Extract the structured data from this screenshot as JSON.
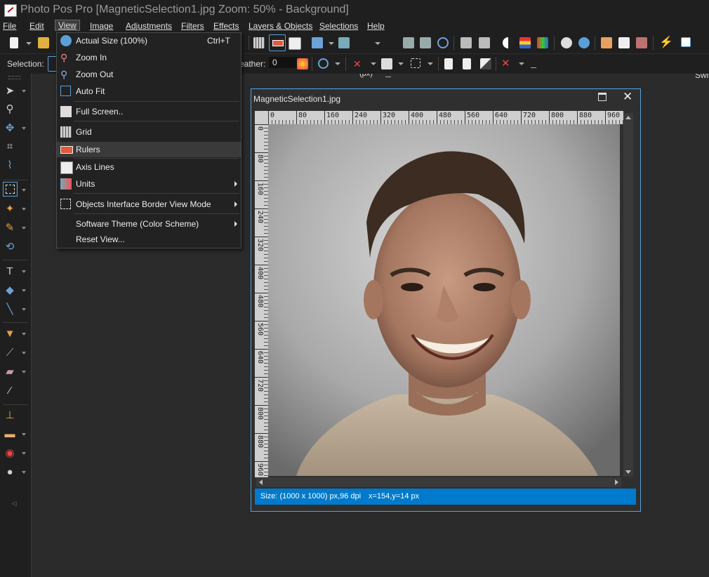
{
  "window": {
    "title": "Photo Pos Pro [MagneticSelection1.jpg Zoom: 50% - Background]"
  },
  "menubar": {
    "items": [
      "File",
      "Edit",
      "View",
      "Image",
      "Adjustments",
      "Filters",
      "Effects",
      "Layers & Objects",
      "Selections",
      "Help"
    ],
    "active": "View"
  },
  "toolbar": {
    "units": "(px)",
    "switch_label": "Swit"
  },
  "toolbar2": {
    "selection_label": "Selection:",
    "feather_label": "eather:",
    "feather_value": "0"
  },
  "view_menu": {
    "items": [
      {
        "label": "Actual Size (100%)",
        "shortcut": "Ctrl+T",
        "icon": "actual-size-icon"
      },
      {
        "label": "Zoom In",
        "icon": "zoom-in-icon"
      },
      {
        "label": "Zoom Out",
        "icon": "zoom-out-icon"
      },
      {
        "label": "Auto Fit",
        "icon": "auto-fit-icon"
      },
      {
        "label": "Full Screen..",
        "icon": "full-screen-icon"
      },
      {
        "label": "Grid",
        "icon": "grid-icon"
      },
      {
        "label": "Rulers",
        "icon": "rulers-icon",
        "highlighted": true
      },
      {
        "label": "Axis Lines",
        "icon": "axis-lines-icon"
      },
      {
        "label": "Units",
        "icon": "units-icon",
        "submenu": true
      },
      {
        "label": "Objects Interface Border View Mode",
        "icon": "border-view-icon",
        "submenu": true
      },
      {
        "label": "Software Theme (Color Scheme)",
        "submenu": true
      },
      {
        "label": "Reset View..."
      }
    ]
  },
  "document": {
    "title": "MagneticSelection1.jpg",
    "h_ruler": [
      "0",
      "80",
      "160",
      "240",
      "320",
      "400",
      "480",
      "560",
      "640",
      "720",
      "800",
      "880",
      "960"
    ],
    "v_ruler": [
      "0",
      "80",
      "160",
      "240",
      "320",
      "400",
      "480",
      "560",
      "640",
      "720",
      "800",
      "880",
      "960"
    ],
    "status_size": "Size: (1000 x 1000) px,96 dpi",
    "status_coords": "x=154,y=14 px"
  },
  "colors": {
    "accent": "#007acc",
    "window_border": "#5aa0d8",
    "background": "#2b2b2b"
  }
}
